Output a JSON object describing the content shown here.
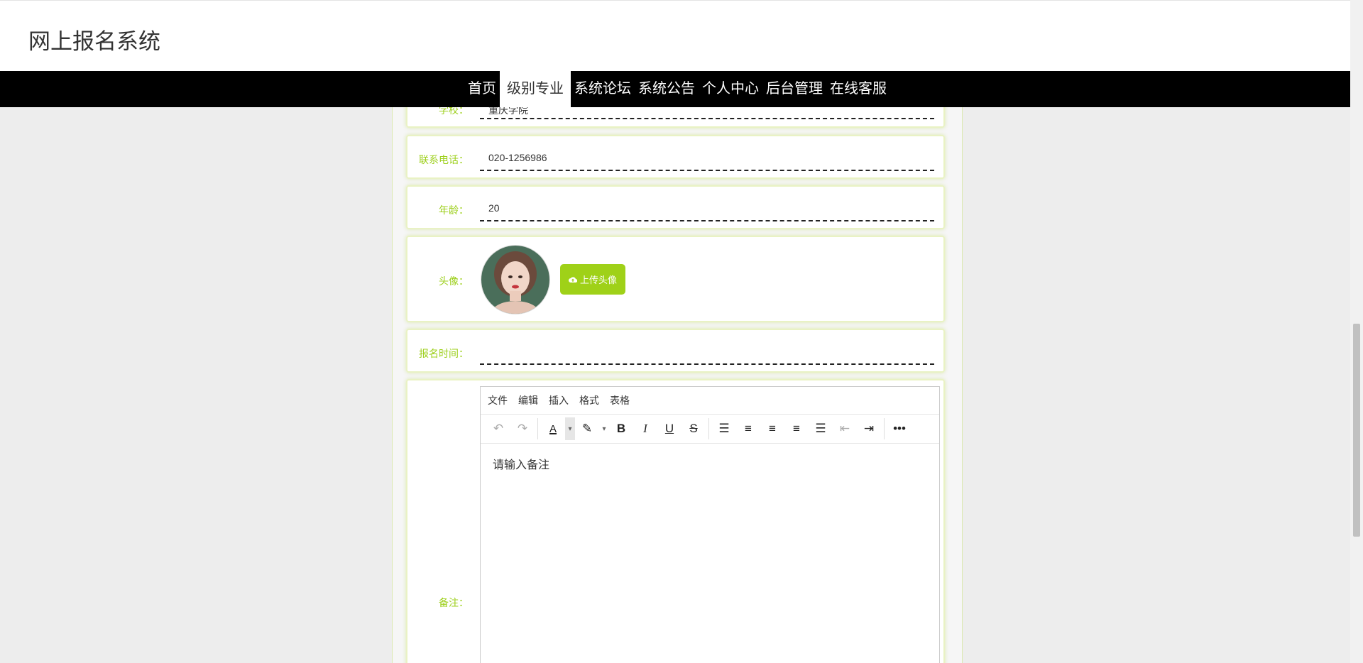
{
  "header": {
    "site_title": "网上报名系统"
  },
  "nav": {
    "items": [
      "首页",
      "级别专业",
      "系统论坛",
      "系统公告",
      "个人中心",
      "后台管理",
      "在线客服"
    ],
    "active_index": 1
  },
  "form": {
    "school": {
      "label": "学校：",
      "value": "重庆学院"
    },
    "phone": {
      "label": "联系电话：",
      "value": "020-1256986"
    },
    "age": {
      "label": "年龄：",
      "value": "20"
    },
    "avatar": {
      "label": "头像：",
      "upload_button": "上传头像"
    },
    "signup_time": {
      "label": "报名时间：",
      "value": ""
    },
    "remark": {
      "label": "备注：",
      "menu": [
        "文件",
        "编辑",
        "插入",
        "格式",
        "表格"
      ],
      "placeholder": "请输入备注"
    }
  },
  "colors": {
    "accent": "#9fd118",
    "label": "#9ccf1a",
    "nav_bg": "#000000"
  },
  "icons": [
    "undo-icon",
    "redo-icon",
    "text-color-icon",
    "highlight-icon",
    "bold-icon",
    "italic-icon",
    "underline-icon",
    "strikethrough-icon",
    "line-height-icon",
    "align-left-icon",
    "align-center-icon",
    "align-right-icon",
    "justify-icon",
    "outdent-icon",
    "indent-icon",
    "more-icon",
    "cloud-upload-icon"
  ]
}
